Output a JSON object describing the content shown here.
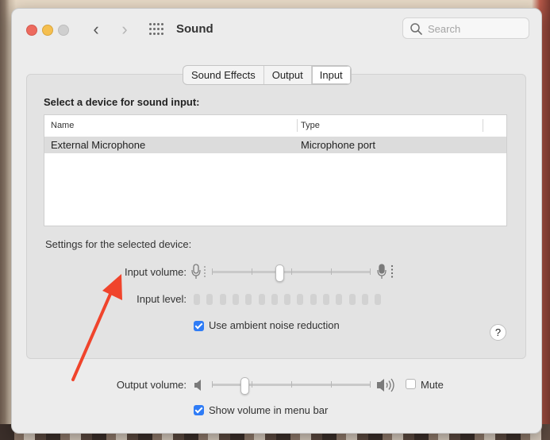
{
  "window": {
    "title": "Sound"
  },
  "search": {
    "placeholder": "Search"
  },
  "tabs": [
    {
      "label": "Sound Effects",
      "active": false
    },
    {
      "label": "Output",
      "active": false
    },
    {
      "label": "Input",
      "active": true
    }
  ],
  "input": {
    "heading": "Select a device for sound input:",
    "columns": [
      "Name",
      "Type"
    ],
    "devices": [
      {
        "name": "External Microphone",
        "type": "Microphone port",
        "selected": true
      }
    ],
    "settings_label": "Settings for the selected device:",
    "volume_label": "Input volume:",
    "volume_level": 0.42,
    "level_label": "Input level:",
    "level_bars": 15,
    "noise_reduction": {
      "label": "Use ambient noise reduction",
      "checked": true
    }
  },
  "output": {
    "volume_label": "Output volume:",
    "volume_level": 0.2,
    "mute": {
      "label": "Mute",
      "checked": false
    },
    "menubar": {
      "label": "Show volume in menu bar",
      "checked": true
    }
  },
  "help": {
    "label": "?"
  },
  "colors": {
    "accent": "#2f7cf6",
    "annotation_arrow": "#f0442c"
  }
}
